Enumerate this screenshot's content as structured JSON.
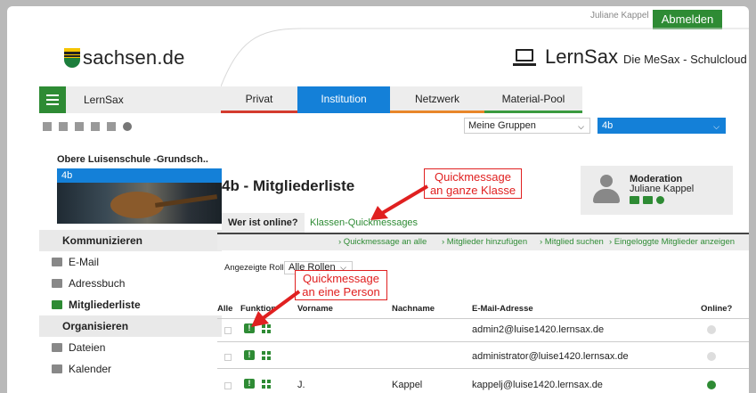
{
  "userbar": {
    "username": "Juliane Kappel",
    "logout_label": "Abmelden"
  },
  "logo": {
    "text": "sachsen.de"
  },
  "brand": {
    "name": "LernSax",
    "subtitle": "Die MeSax - Schulcloud"
  },
  "nav": {
    "app_label": "LernSax",
    "tabs": [
      {
        "label": "Privat",
        "color": "#d43b2e"
      },
      {
        "label": "Institution",
        "color": "#1480d8"
      },
      {
        "label": "Netzwerk",
        "color": "#e8862a"
      },
      {
        "label": "Material-Pool",
        "color": "#3a9a3f"
      }
    ]
  },
  "selectors": {
    "groups_label": "Meine Gruppen",
    "current_group": "4b"
  },
  "sidebar": {
    "school": "Obere Luisenschule -Grundsch..",
    "group": "4b",
    "sections": [
      {
        "title": "Kommunizieren",
        "items": [
          "E-Mail",
          "Adressbuch",
          "Mitgliederliste"
        ]
      },
      {
        "title": "Organisieren",
        "items": [
          "Dateien",
          "Kalender"
        ]
      }
    ]
  },
  "main": {
    "title": "4b - Mitgliederliste",
    "subtabs": [
      "Wer ist online?",
      "Klassen-Quickmessages"
    ],
    "actions": [
      "› Quickmessage an alle",
      "› Mitglieder hinzufügen",
      "› Mitglied suchen",
      "› Eingeloggte Mitglieder anzeigen"
    ],
    "role_label": "Angezeigte Rolle",
    "role_value": "Alle Rollen",
    "columns": [
      "Alle",
      "Funktion",
      "Vorname",
      "Nachname",
      "E-Mail-Adresse",
      "Online?"
    ],
    "rows": [
      {
        "vorname": "",
        "nachname": "",
        "email": "admin2@luise1420.lernsax.de",
        "online": false
      },
      {
        "vorname": "",
        "nachname": "",
        "email": "administrator@luise1420.lernsax.de",
        "online": false
      },
      {
        "vorname": "J.",
        "nachname": "Kappel",
        "email": "kappelj@luise1420.lernsax.de",
        "online": true
      }
    ]
  },
  "moderation": {
    "title": "Moderation",
    "name": "Juliane Kappel"
  },
  "annotations": {
    "class_msg": [
      "Quickmessage",
      "an ganze Klasse"
    ],
    "person_msg": [
      "Quickmessage",
      "an eine Person"
    ]
  }
}
